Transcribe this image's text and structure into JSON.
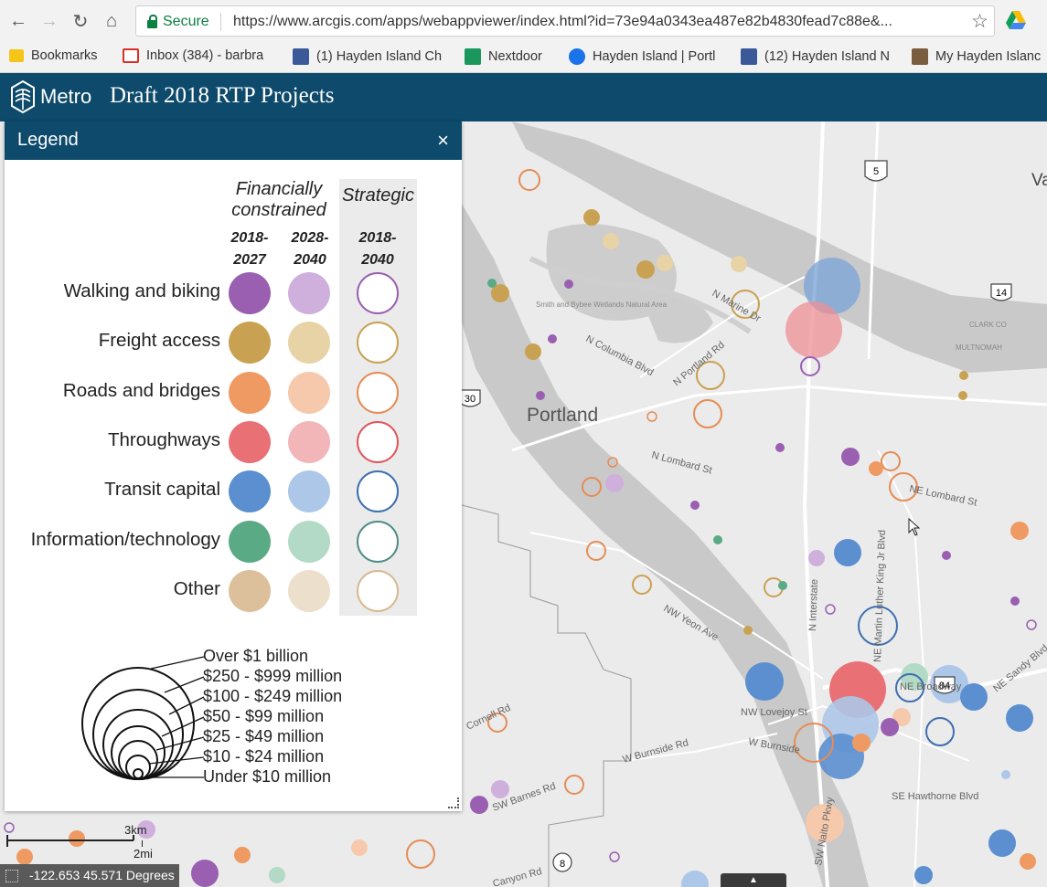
{
  "browser": {
    "secure_label": "Secure",
    "url": "https://www.arcgis.com/apps/webappviewer/index.html?id=73e94a0343ea487e82b4830fead7c88e&...",
    "bookmarks": [
      {
        "label": "Bookmarks",
        "color": "#f5c518"
      },
      {
        "label": "Inbox (384) - barbra",
        "color": "#d93025"
      },
      {
        "label": "(1) Hayden Island Ch",
        "color": "#3b5998"
      },
      {
        "label": "Nextdoor",
        "color": "#19975d"
      },
      {
        "label": "Hayden Island | Portl",
        "color": "#1a73e8"
      },
      {
        "label": "(12) Hayden Island N",
        "color": "#3b5998"
      },
      {
        "label": "My Hayden Islanc",
        "color": "#7a5c3e"
      }
    ]
  },
  "app": {
    "brand": "Metro",
    "title": "Draft 2018 RTP Projects"
  },
  "legend": {
    "title": "Legend",
    "close": "×",
    "headers": {
      "financial_line1": "Financially",
      "financial_line2": "constrained",
      "strategic": "Strategic",
      "col1_line1": "2018-",
      "col1_line2": "2027",
      "col2_line1": "2028-",
      "col2_line2": "2040",
      "col3_line1": "2018-",
      "col3_line2": "2040"
    },
    "rows": [
      {
        "label": "Walking and biking",
        "c1": "#9a5fb1",
        "c2": "#cfb0dd",
        "c3": "#9a5fb1"
      },
      {
        "label": "Freight access",
        "c1": "#c9a152",
        "c2": "#e8d3a7",
        "c3": "#c9a152"
      },
      {
        "label": "Roads and bridges",
        "c1": "#ef9a62",
        "c2": "#f6c9ad",
        "c3": "#e68c55"
      },
      {
        "label": "Throughways",
        "c1": "#e97074",
        "c2": "#f2b6b9",
        "c3": "#e0565c"
      },
      {
        "label": "Transit capital",
        "c1": "#5b8fd0",
        "c2": "#adc7e8",
        "c3": "#3d6fb0"
      },
      {
        "label": "Information/technology",
        "c1": "#5aaa86",
        "c2": "#b3dac7",
        "c3": "#4f8d86"
      },
      {
        "label": "Other",
        "c1": "#dcc09b",
        "c2": "#ecdfcc",
        "c3": "#d6b98f"
      }
    ],
    "sizes": [
      "Over $1 billion",
      "$250 - $999 million",
      "$100 - $249 million",
      "$50 - $99 million",
      "$25 - $49 million",
      "$10 - $24 million",
      "Under $10 million"
    ]
  },
  "map": {
    "city_label": "Portland",
    "streets": [
      "N Columbia Blvd",
      "N Portland Rd",
      "N Marine Dr",
      "N Lombard St",
      "NE Lombard St",
      "NW Yeon Ave",
      "N Interstate",
      "NE Martin Luther King Jr Blvd",
      "NE Broadway",
      "NW Lovejoy St",
      "W Burnside",
      "W Burnside Rd",
      "Cornell Rd",
      "SW Barnes Rd",
      "SE Hawthorne Blvd",
      "NE Sandy Blvd",
      "SW Naito Pkwy",
      "Canyon Rd",
      "Smith and Bybee Wetlands Natural Area",
      "CLARK CO",
      "MULTNOMAH"
    ],
    "shields": [
      "5",
      "14",
      "30",
      "84",
      "8"
    ],
    "partial_label": "Va"
  },
  "scale": {
    "km": "3km",
    "mi": "2mi"
  },
  "coords": "-122.653 45.571 Degrees"
}
